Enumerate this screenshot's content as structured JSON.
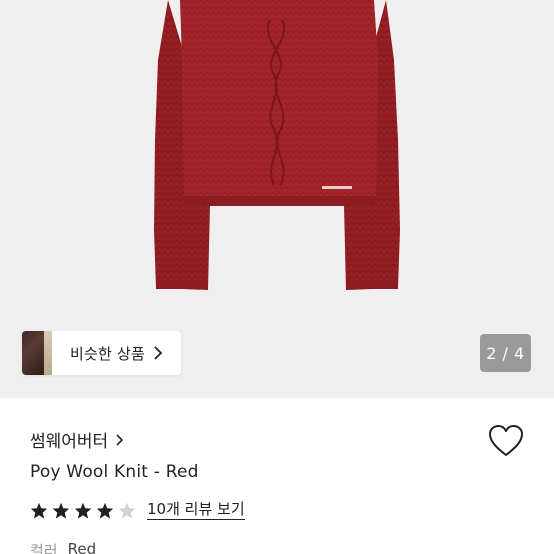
{
  "gallery": {
    "similar_label": "비슷한 상품",
    "pager": "2 / 4"
  },
  "product": {
    "brand": "썸웨어버터",
    "name": "Poy Wool Knit - Red",
    "rating": 4,
    "rating_max": 5,
    "review_link": "10개 리뷰 보기",
    "option_label": "컬러",
    "option_value": "Red"
  },
  "colors": {
    "sweater": "#a3242a",
    "star_filled": "#222222",
    "star_empty": "#d0d0d0",
    "pager_bg": "#9a9a9a"
  },
  "icons": [
    "chevron-right-icon",
    "heart-icon",
    "star-icon"
  ]
}
